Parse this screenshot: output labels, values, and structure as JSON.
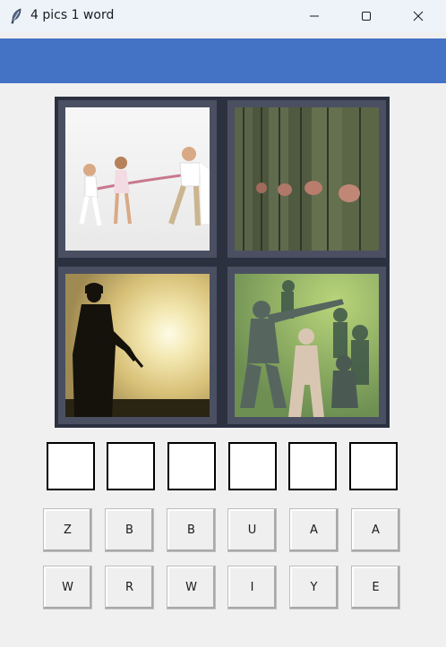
{
  "window": {
    "title": "4 pics 1 word"
  },
  "images": [
    {
      "icon": "tug-of-war-children-photo"
    },
    {
      "icon": "soldiers-in-line-photo"
    },
    {
      "icon": "soldier-silhouette-sunset-photo"
    },
    {
      "icon": "toy-army-men-photo"
    }
  ],
  "answer_slots": [
    "",
    "",
    "",
    "",
    "",
    ""
  ],
  "letters_row1": [
    "Z",
    "B",
    "B",
    "U",
    "A",
    "A"
  ],
  "letters_row2": [
    "W",
    "R",
    "W",
    "I",
    "Y",
    "E"
  ],
  "colors": {
    "header": "#4472c4",
    "background": "#f0f0f0"
  }
}
